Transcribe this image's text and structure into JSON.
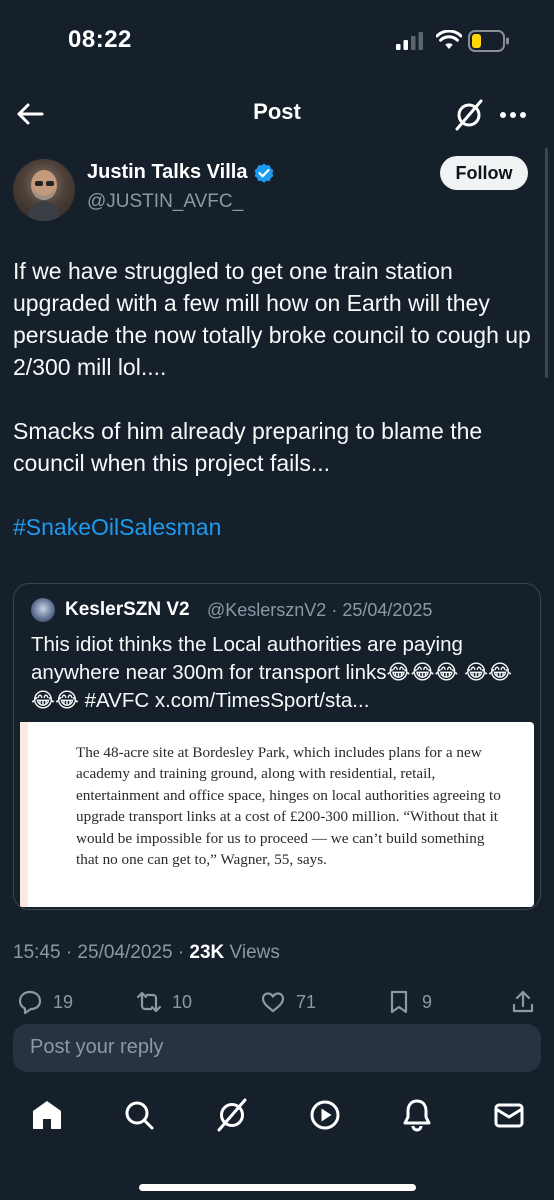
{
  "status_bar": {
    "time": "08:22"
  },
  "header": {
    "title": "Post"
  },
  "author": {
    "name": "Justin Talks Villa",
    "handle": "@JUSTIN_AVFC_",
    "follow_label": "Follow"
  },
  "post": {
    "text": "If we have struggled to get one train station upgraded with a few mill how on Earth will they persuade the now totally broke council to cough up 2/300 mill lol....\n\nSmacks of him already preparing to blame the council when this project fails...",
    "hashtag": "#SnakeOilSalesman"
  },
  "quote": {
    "name": "KeslerSZN V2",
    "handle_date": "@KeslersznV2 · 25/04/2025",
    "text": "This idiot thinks the Local authorities are paying anywhere near 300m for transport links😂😂😂 😂😂😂😂 #AVFC x.com/TimesSport/sta...",
    "image_text": "The 48-acre site at Bordesley Park, which includes plans for a new academy and training ground, along with residential, retail, entertainment and office space, hinges on local authorities agreeing to upgrade transport links at a cost of £200-300 million. “Without that it would be impossible for us to proceed — we can’t build something that no one can get to,” Wagner, 55, says."
  },
  "meta": {
    "timestamp": "15:45 · 25/04/2025 · ",
    "views_count": "23K",
    "views_label": " Views"
  },
  "actions": {
    "replies": "19",
    "reposts": "10",
    "likes": "71",
    "bookmarks": "9"
  },
  "reply": {
    "placeholder": "Post your reply"
  },
  "icons": [
    "back-arrow-icon",
    "grok-icon",
    "more-icon",
    "verified-badge-icon",
    "reply-icon",
    "repost-icon",
    "like-icon",
    "bookmark-icon",
    "share-icon",
    "home-icon",
    "search-icon",
    "grok-icon",
    "video-icon",
    "notifications-icon",
    "messages-icon"
  ],
  "colors": {
    "background": "#15202b",
    "accent": "#1d9bf0",
    "muted": "#8b98a5",
    "border": "#38444d",
    "reply_box": "#273340"
  }
}
